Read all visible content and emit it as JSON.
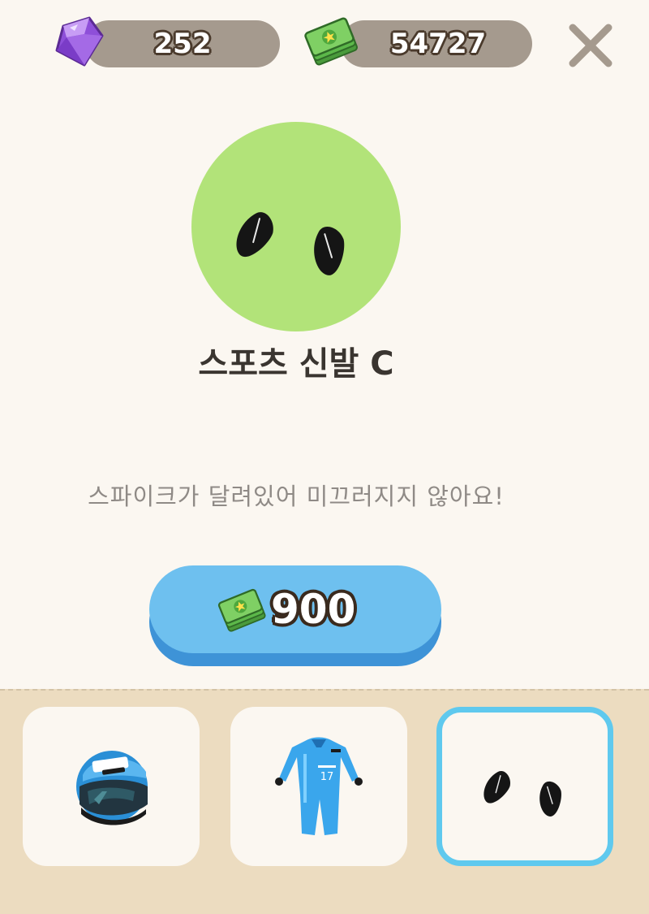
{
  "currency": {
    "gems": "252",
    "cash": "54727"
  },
  "item": {
    "name": "스포츠 신발 C",
    "description": "스파이크가 달려있어 미끄러지지 않아요!",
    "price": "900",
    "price_currency_icon": "cash-icon"
  },
  "icons": {
    "gems": "gem-icon",
    "cash": "cash-icon",
    "close": "close-icon"
  },
  "slots": [
    {
      "item": "helmet",
      "icon": "helmet-icon",
      "selected": false
    },
    {
      "item": "suit",
      "icon": "suit-icon",
      "selected": false
    },
    {
      "item": "shoes",
      "icon": "shoes-icon",
      "selected": true
    }
  ],
  "colors": {
    "background": "#fbf7f1",
    "preview_circle": "#b2e379",
    "buy_button": "#6ec0ef",
    "selected_border": "#5fc9ee",
    "tray": "#ecdcc0"
  }
}
